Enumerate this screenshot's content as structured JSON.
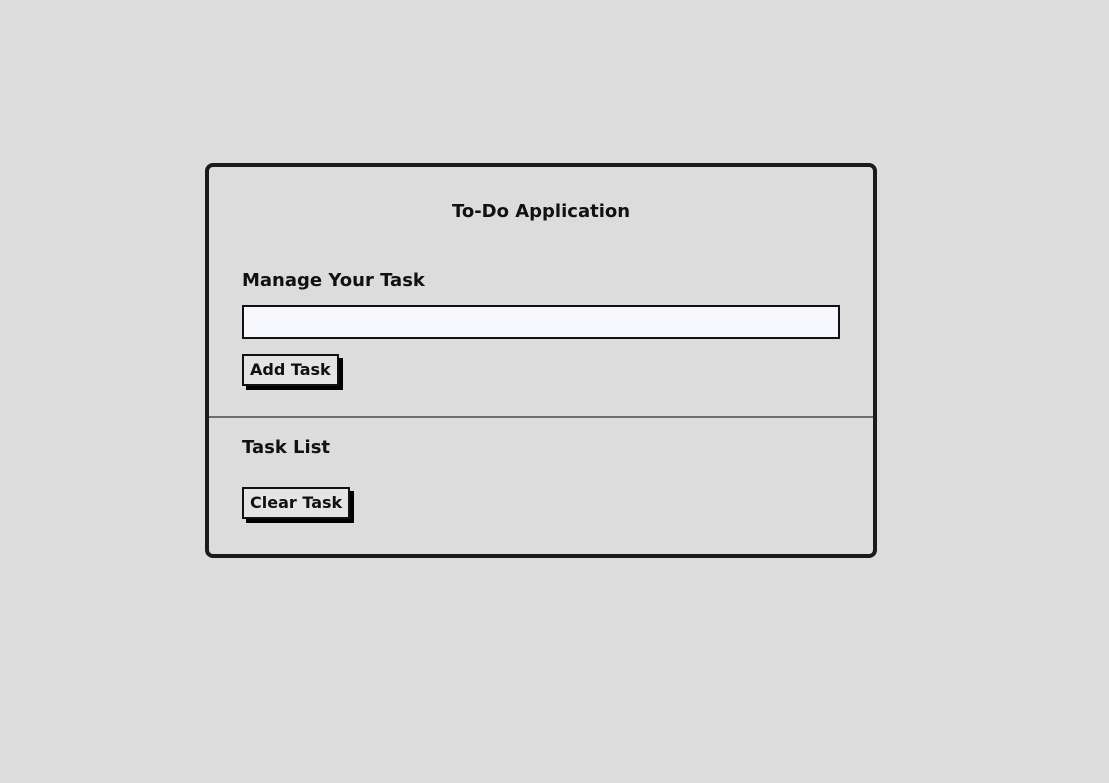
{
  "app": {
    "title": "To-Do Application"
  },
  "manage": {
    "heading": "Manage Your Task",
    "input_value": "",
    "input_placeholder": "",
    "add_button_label": "Add Task"
  },
  "task_list": {
    "heading": "Task List",
    "items": [],
    "clear_button_label": "Clear Task"
  },
  "colors": {
    "background": "#dcdcdc",
    "border": "#1a1a1a",
    "input_background": "#f7f8fd",
    "divider": "#6e6e6e"
  }
}
